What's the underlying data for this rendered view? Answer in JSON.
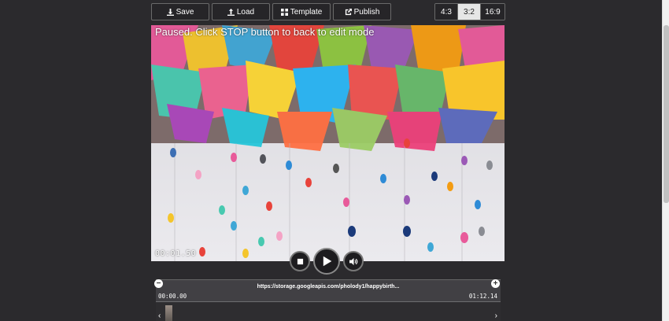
{
  "toolbar": {
    "save_label": "Save",
    "load_label": "Load",
    "template_label": "Template",
    "publish_label": "Publish"
  },
  "ratios": {
    "r43": "4:3",
    "r32": "3:2",
    "r169": "16:9",
    "active": "3:2"
  },
  "stage": {
    "paused_message": "Paused. Click STOP button to back to edit mode",
    "timecode": "00:01.50"
  },
  "timeline": {
    "url": "https://storage.googleapis.com/pholody1/happybirth...",
    "start_time": "00:00.00",
    "end_time": "01:12.14"
  },
  "icons": {
    "save": "download-icon",
    "load": "upload-icon",
    "template": "grid-icon",
    "publish": "share-icon",
    "stop": "stop-icon",
    "play": "play-icon",
    "volume": "volume-icon",
    "zoom_out": "minus-icon",
    "zoom_in": "plus-icon",
    "prev": "chevron-left-icon",
    "next": "chevron-right-icon"
  }
}
